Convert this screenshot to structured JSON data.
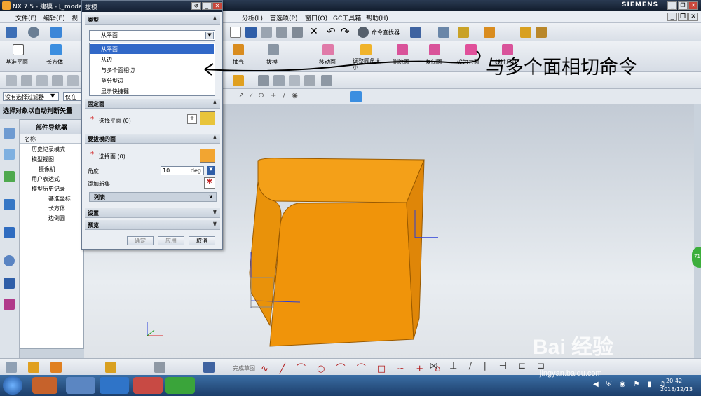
{
  "titlebar": {
    "title": "NX 7.5 - 建模 - [_mode",
    "brand": "SIEMENS"
  },
  "menubar": {
    "items": [
      "文件(F)",
      "编辑(E)",
      "视",
      "分析(L)",
      "首选项(P)",
      "窗口(O)",
      "GC工具箱",
      "帮助(H)"
    ]
  },
  "toolbar1": {
    "command_finder": "命令查找器"
  },
  "toolbar2": {
    "datum_plane": "基准平面",
    "block": "长方体",
    "shell": "抽壳",
    "draft": "拔模",
    "move_face": "移动面",
    "resize_fillet": "调整圆角大小",
    "delete_face": "删除面",
    "copy_face": "复制面",
    "make_coplanar": "设为共面",
    "linear_dimension": "线性尺寸"
  },
  "filterbar": {
    "filter": "没有选择过滤器",
    "scope": "仅在"
  },
  "statusline": "选择对象以自动判断矢量",
  "navigator": {
    "title": "部件导航器",
    "column": "名称",
    "rows": [
      "历史记录模式",
      "模型视图",
      "摄像机",
      "用户表达式",
      "模型历史记录",
      "基准坐标",
      "长方体",
      "边倒圆"
    ]
  },
  "dialog": {
    "title": "拔模",
    "type_section": "类型",
    "type_selected": "从平面",
    "type_options": [
      "从平面",
      "从边",
      "与多个面相切",
      "至分型边",
      "显示快捷键"
    ],
    "fixed_face_section": "固定面",
    "select_plane": "选择平面 (0)",
    "faces_section": "要拔模的面",
    "select_face": "选择面 (0)",
    "angle_label": "角度",
    "angle_value": "10",
    "angle_unit": "deg",
    "add_new_set": "添加新集",
    "list_label": "列表",
    "settings_section": "设置",
    "preview_section": "预览",
    "ok": "确定",
    "apply": "应用",
    "cancel": "取消"
  },
  "bottombar": {
    "finish_sketch": "完成草图"
  },
  "annotation": "与多个面相切命令",
  "taskbar": {
    "time": "20:42",
    "date": "2018/12/13"
  },
  "watermark": {
    "brand": "Bai 经验",
    "url": "jingyan.baidu.com"
  },
  "side_badge": "71",
  "colors": {
    "solid": "#f39a0a",
    "solid_dark": "#c96f00",
    "selection": "#3168c8",
    "title": "#142033"
  }
}
